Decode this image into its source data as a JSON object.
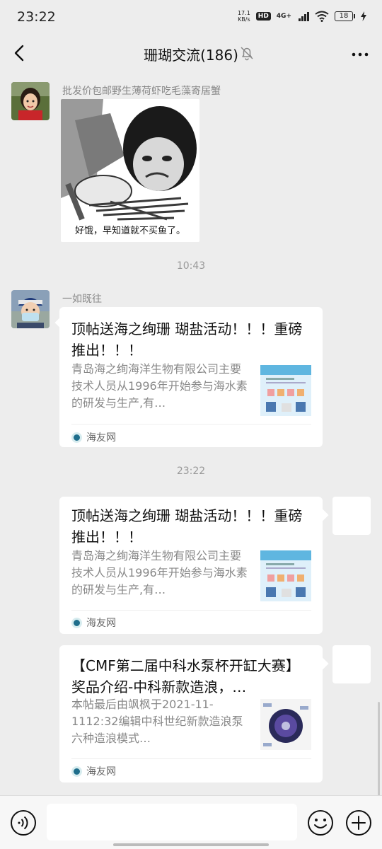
{
  "status_bar": {
    "time": "23:22",
    "net_speed_value": "17.1",
    "net_speed_unit": "KB/s",
    "hd_label": "HD",
    "network_label": "4G+",
    "battery": "18"
  },
  "header": {
    "title": "珊瑚交流(186)",
    "back_icon": "chevron-left-icon",
    "mute_icon": "bell-off-icon",
    "more_icon": "more-dots-icon"
  },
  "messages": {
    "msg1": {
      "sender": "批发价包邮野生薄荷虾吃毛藻寄居蟹",
      "sticker_caption": "好饿，早知道就不买鱼了。"
    },
    "time1": "10:43",
    "msg2": {
      "sender": "一如既往",
      "card_title": "顶帖送海之绚珊 瑚盐活动！！！重磅推出！！！",
      "card_desc": "青岛海之绚海洋生物有限公司主要技术人员从1996年开始参与海水素的研发与生产,有…",
      "source": "海友网"
    },
    "time2": "23:22",
    "msg3": {
      "card_title": "顶帖送海之绚珊 瑚盐活动！！！重磅推出！！！",
      "card_desc": "青岛海之绚海洋生物有限公司主要技术人员从1996年开始参与海水素的研发与生产,有…",
      "source": "海友网"
    },
    "msg4": {
      "card_title": "【CMF第二届中科水泵杯开缸大赛】奖品介绍-中科新款造浪，…",
      "card_desc": "本帖最后由飒枫于2021-11-1112:32编辑中科世纪新款造浪泵六种造浪模式…",
      "source": "海友网"
    }
  },
  "input_bar": {
    "voice_icon": "voice-icon",
    "text_value": "",
    "emoji_icon": "emoji-icon",
    "plus_icon": "plus-icon"
  },
  "colors": {
    "background": "#ededed",
    "card": "#ffffff",
    "muted_text": "#888888"
  }
}
